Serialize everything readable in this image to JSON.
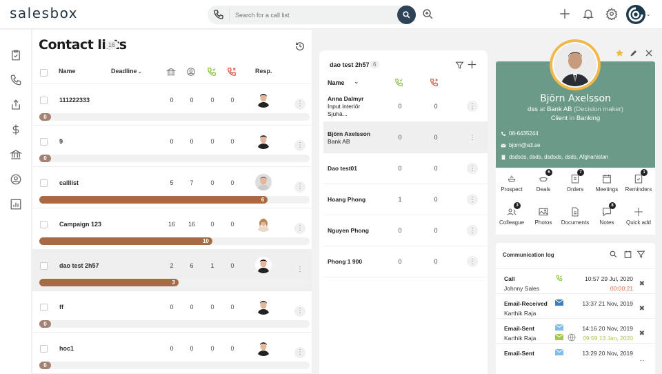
{
  "app": {
    "logo": "salesbox"
  },
  "search": {
    "placeholder": "Search for a call list",
    "value": ""
  },
  "topbar": {
    "icons": [
      "phone-icon",
      "search-icon",
      "zoom-in-icon",
      "plus-icon",
      "bell-icon",
      "gear-icon",
      "account-avatar",
      "chevron-down-icon"
    ]
  },
  "sidenav": {
    "items": [
      "tasks-icon",
      "calls-icon",
      "upload-icon",
      "dollar-icon",
      "bank-icon",
      "contact-icon",
      "reports-icon"
    ]
  },
  "lists": {
    "title": "Contact lists",
    "count": "16",
    "headers": {
      "name": "Name",
      "deadline": "Deadline",
      "resp": "Resp."
    },
    "rows": [
      {
        "name": "111222333",
        "n1": "0",
        "n2": "0",
        "n3": "0",
        "n4": "0",
        "progress": "0",
        "fraction": 0
      },
      {
        "name": "9",
        "n1": "0",
        "n2": "0",
        "n3": "0",
        "n4": "0",
        "progress": "0",
        "fraction": 0
      },
      {
        "name": "calllist",
        "n1": "5",
        "n2": "7",
        "n3": "0",
        "n4": "0",
        "progress": "6",
        "fraction": 0.845
      },
      {
        "name": "Campaign 123",
        "n1": "16",
        "n2": "16",
        "n3": "0",
        "n4": "0",
        "progress": "10",
        "fraction": 0.64
      },
      {
        "name": "dao test 2h57",
        "n1": "2",
        "n2": "6",
        "n3": "1",
        "n4": "0",
        "progress": "3",
        "fraction": 0.515,
        "selected": true
      },
      {
        "name": "ff",
        "n1": "0",
        "n2": "0",
        "n3": "0",
        "n4": "0",
        "progress": "0",
        "fraction": 0
      },
      {
        "name": "hoc1",
        "n1": "0",
        "n2": "0",
        "n3": "0",
        "n4": "0",
        "progress": "0",
        "fraction": 0
      }
    ]
  },
  "contacts": {
    "title": "dao test 2h57",
    "count": "6",
    "header_name": "Name",
    "rows": [
      {
        "name": "Anna Dalmyr",
        "sub1": "Input interiör",
        "sub2": "Sjuhä...",
        "v1": "0",
        "v2": "0"
      },
      {
        "name": "Björn Axelsson",
        "sub1": "Bank AB",
        "sub2": "",
        "v1": "0",
        "v2": "0",
        "selected": true
      },
      {
        "name": "Dao test01",
        "sub1": "",
        "sub2": "",
        "v1": "0",
        "v2": "0"
      },
      {
        "name": "Hoang Phong",
        "sub1": "",
        "sub2": "",
        "v1": "1",
        "v2": "0"
      },
      {
        "name": "Nguyen Phong",
        "sub1": "",
        "sub2": "",
        "v1": "0",
        "v2": "0"
      },
      {
        "name": "Phong 1 900",
        "sub1": "",
        "sub2": "",
        "v1": "0",
        "v2": "0"
      }
    ]
  },
  "profile": {
    "name": "Björn Axelsson",
    "title": "dss",
    "at": "at",
    "company": "Bank AB",
    "role": "(Decision maker)",
    "type": "Client",
    "in": "in",
    "industry": "Banking",
    "phone": "08-6435244",
    "email": "bjorn@a3.se",
    "address": "dsdsds, dsds, dsdsds, dsds, Afghanistan",
    "accent_color": "#6b9a89",
    "ring_color": "#f1b84a"
  },
  "actions": [
    {
      "label": "Prospect",
      "badge": ""
    },
    {
      "label": "Deals",
      "badge": "6"
    },
    {
      "label": "Orders",
      "badge": "7"
    },
    {
      "label": "Meetings",
      "badge": ""
    },
    {
      "label": "Reminders",
      "badge": "1"
    },
    {
      "label": "Colleague",
      "badge": "3"
    },
    {
      "label": "Photos",
      "badge": ""
    },
    {
      "label": "Documents",
      "badge": ""
    },
    {
      "label": "Notes",
      "badge": "8"
    },
    {
      "label": "Quick add",
      "badge": ""
    }
  ],
  "commlog": {
    "title": "Communication log",
    "entries": [
      {
        "type": "Call",
        "who": "Johnny Sales",
        "time": "10:57 29 Jul, 2020",
        "time2": "00:00:21",
        "time2_color": "#e0674f"
      },
      {
        "type": "Email-Received",
        "who": "Karthik Raja",
        "time": "13:37 21 Nov, 2019",
        "time2": "",
        "time2_color": ""
      },
      {
        "type": "Email-Sent",
        "who": "Karthik Raja",
        "time": "14:16 20 Nov, 2019",
        "time2": "09:59 13 Jan, 2020",
        "time2_color": "#a6c84a"
      },
      {
        "type": "Email-Sent",
        "who": "",
        "time": "13:29 20 Nov, 2019",
        "time2": "",
        "time2_color": ""
      }
    ]
  }
}
